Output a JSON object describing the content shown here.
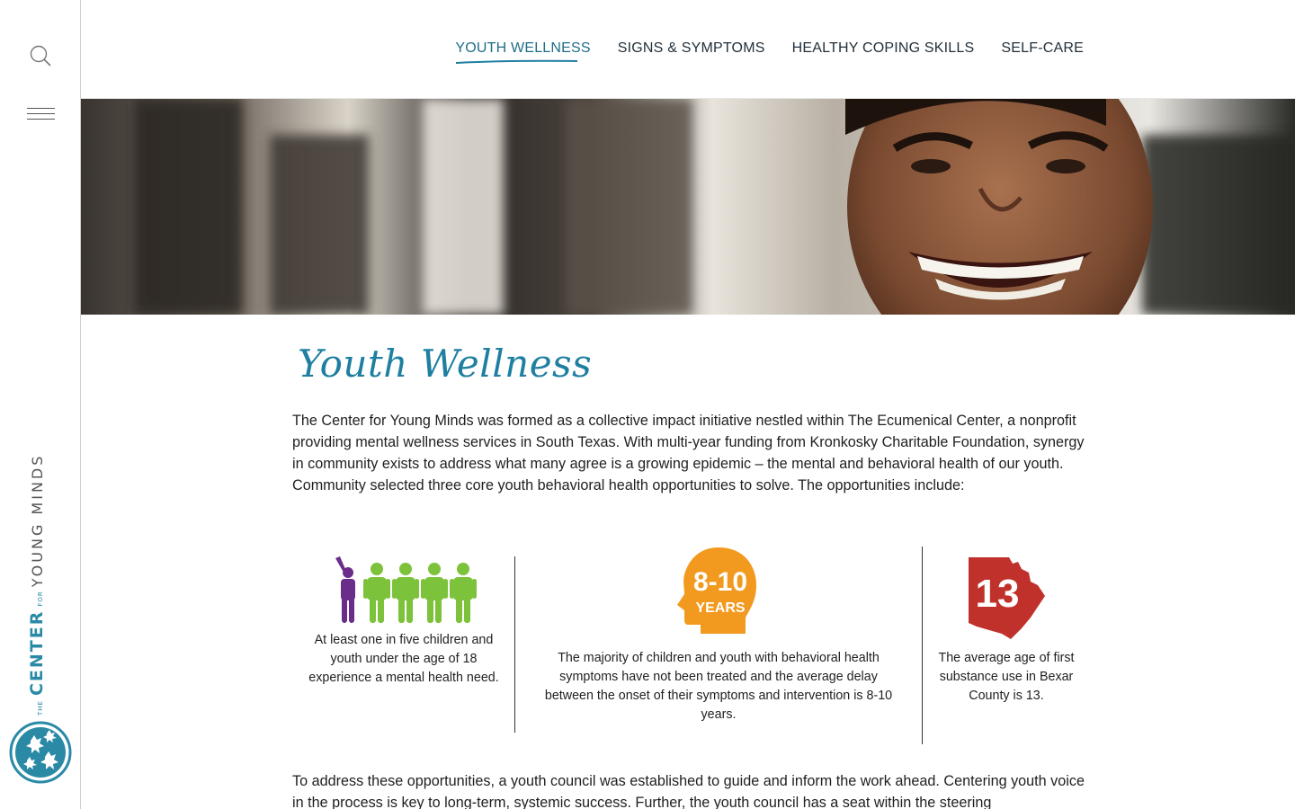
{
  "sidebar": {
    "search_icon": "search-icon",
    "menu_icon": "hamburger-icon",
    "brand": {
      "the": "THE",
      "center": "CENTER",
      "for": "FOR",
      "young_minds": "YOUNG MINDS"
    },
    "logo_icon": "leaves-logo-icon"
  },
  "nav": {
    "items": [
      {
        "label": "YOUTH WELLNESS",
        "active": true
      },
      {
        "label": "SIGNS & SYMPTOMS",
        "active": false
      },
      {
        "label": "HEALTHY COPING SKILLS",
        "active": false
      },
      {
        "label": "SELF-CARE",
        "active": false
      }
    ]
  },
  "hero": {
    "image": "smiling-youth-photo"
  },
  "main": {
    "title": "Youth Wellness",
    "intro": "The Center for Young Minds was formed as a collective impact initiative nestled within The Ecumenical Center, a nonprofit providing mental wellness services in South Texas. With multi-year funding from Kronkosky Charitable Foundation, synergy in community exists to address what many agree is a growing epidemic – the mental and behavioral health of our youth. Community selected three core youth behavioral health opportunities to solve. The opportunities include:",
    "stats": [
      {
        "icon": "five-people-icon",
        "text": "At least one in five children and youth under the age of 18 experience a mental health need."
      },
      {
        "icon": "head-profile-icon",
        "big": "8-10",
        "small": "YEARS",
        "text": "The majority of children and youth with behavioral health symptoms have not been treated and the average delay between the onset of their symptoms and intervention is 8-10 years."
      },
      {
        "icon": "bexar-county-map-icon",
        "big": "13",
        "text": "The average age of first substance use in Bexar County is 13."
      }
    ],
    "closing": "To address these opportunities, a youth council was established to guide and inform the work ahead. Centering youth voice in the process is key to long-term, systemic success. Further, the youth council has a seat within the steering"
  },
  "colors": {
    "teal": "#1e7fa0",
    "purple": "#6b2d8a",
    "green": "#7cc23a",
    "orange": "#f29a1f",
    "red": "#c0312b"
  }
}
